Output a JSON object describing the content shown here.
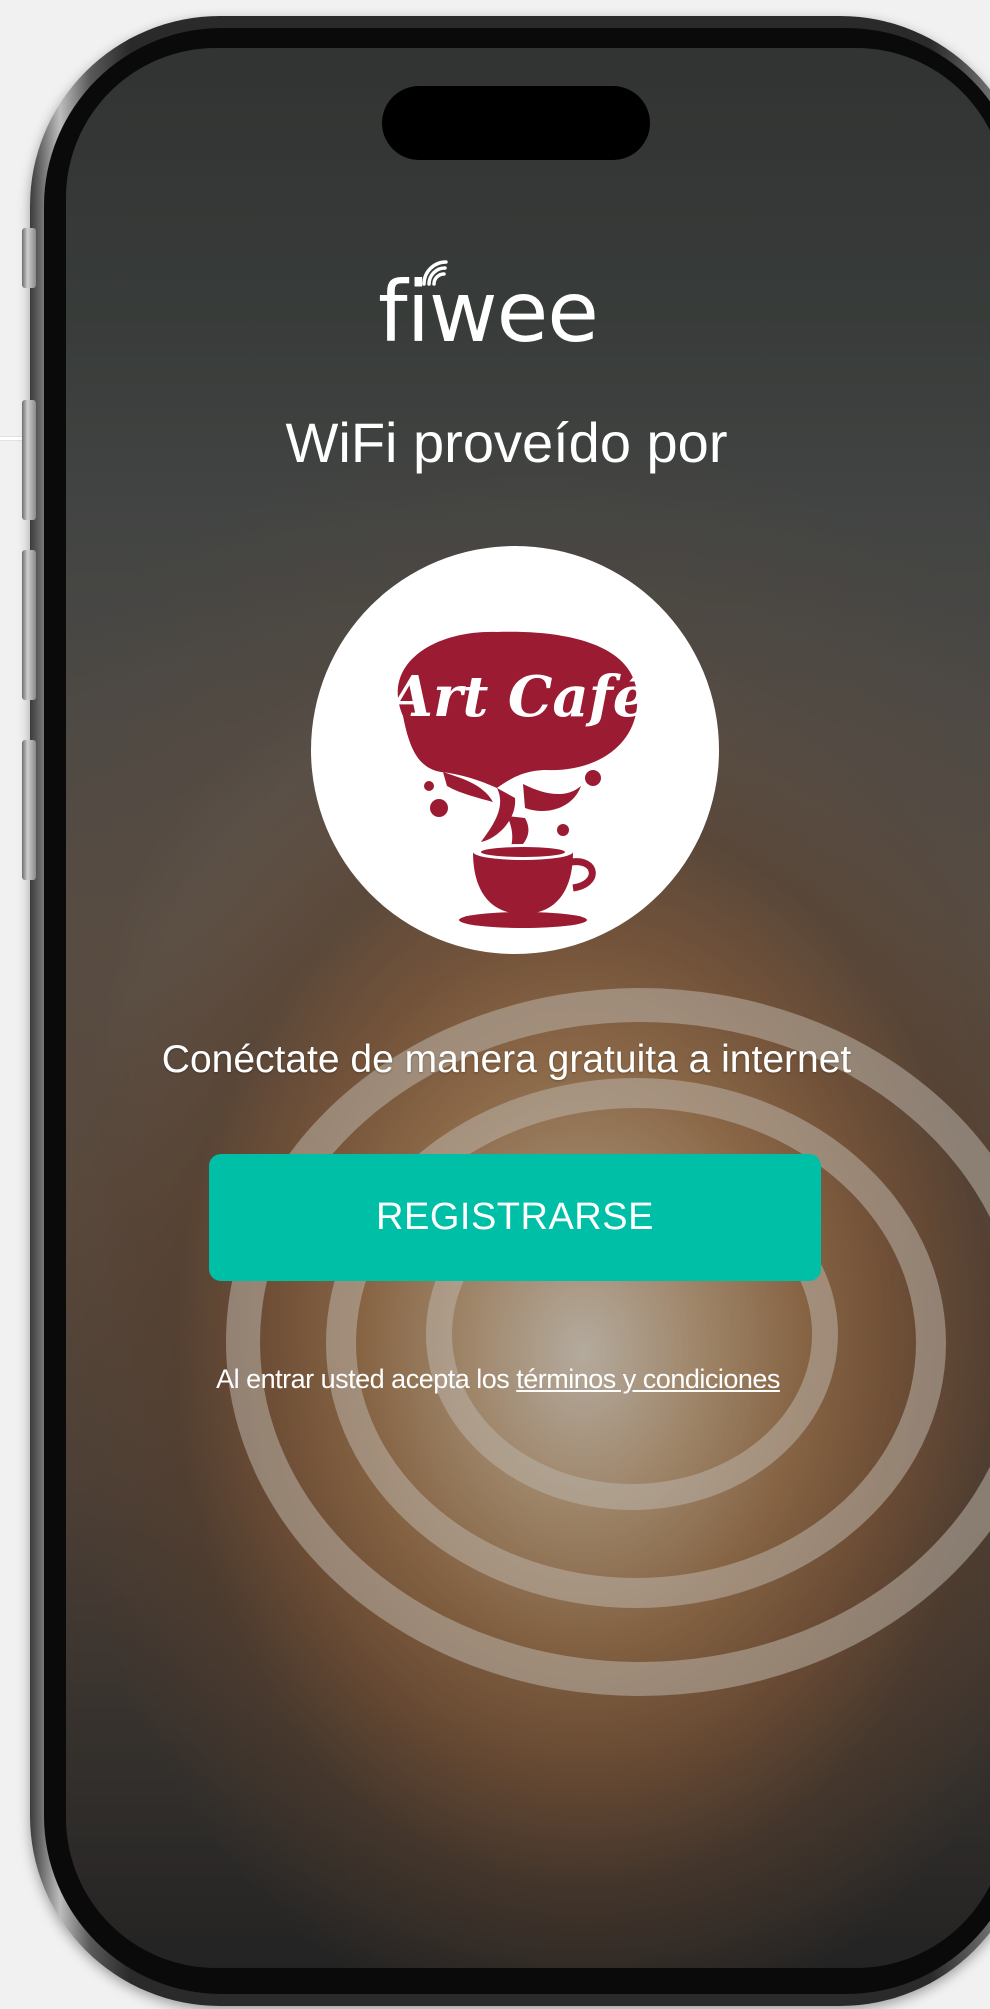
{
  "brand": {
    "name": "fiwee",
    "icon": "wifi-signal-icon"
  },
  "provided_by_label": "WiFi proveído por",
  "venue": {
    "logo_text": "Art Café",
    "logo_icon": "coffee-cup-splash-icon",
    "logo_color": "#9b1b32"
  },
  "tagline": "Conéctate de manera gratuita a internet",
  "register_button": {
    "label": "REGISTRARSE",
    "color": "#00bfa7"
  },
  "terms": {
    "prefix": "Al entrar usted acepta los ",
    "link_text": "términos y condiciones"
  }
}
